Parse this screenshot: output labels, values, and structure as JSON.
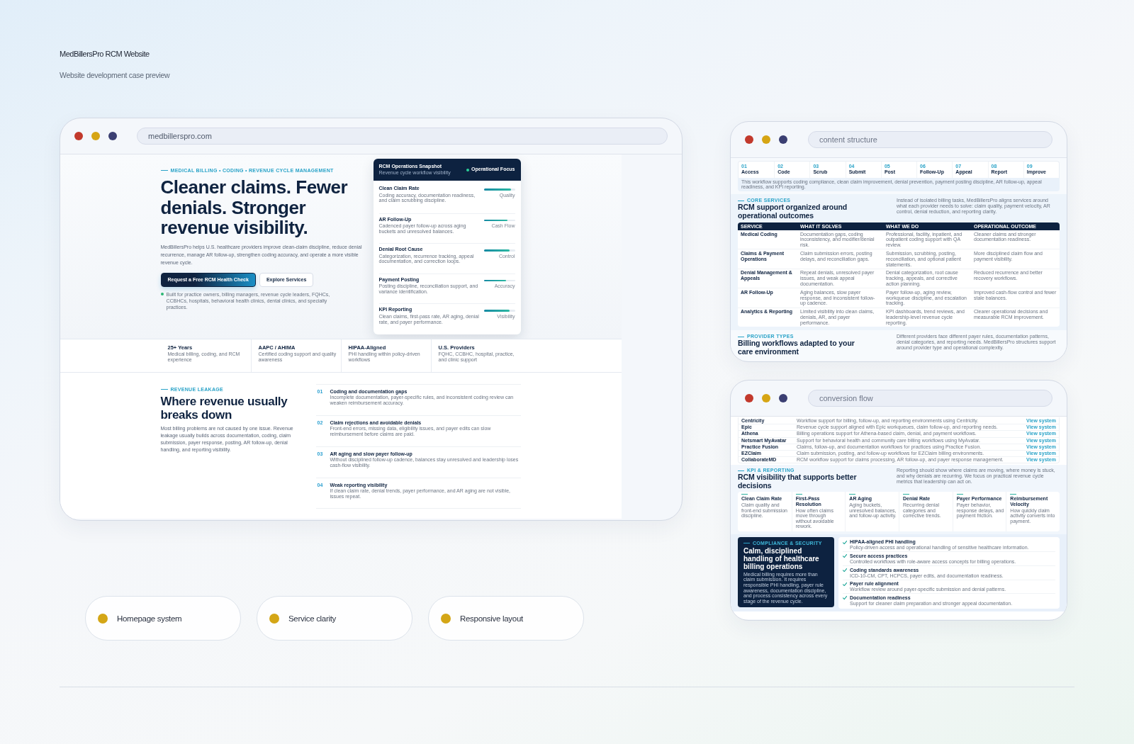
{
  "header": {
    "title": "MedBillersPro RCM Website",
    "subtitle": "Website development case preview"
  },
  "homepage_window": {
    "url": "medbillerspro.com",
    "hero": {
      "eyebrow": "MEDICAL BILLING • CODING • REVENUE CYCLE MANAGEMENT",
      "headline": "Cleaner claims. Fewer denials. Stronger revenue visibility.",
      "intro": "MedBillersPro helps U.S. healthcare providers improve clean-claim discipline, reduce denial recurrence, manage AR follow-up, strengthen coding accuracy, and operate a more visible revenue cycle.",
      "buttons": [
        {
          "label": "Request a Free RCM Health Check",
          "kind": "primary"
        },
        {
          "label": "Explore Services",
          "kind": "secondary"
        }
      ],
      "audience_note": "Built for practice owners, billing managers, revenue cycle leaders, FQHCs, CCBHCs, hospitals, behavioral health clinics, dental clinics, and specialty practices."
    },
    "snapshot": {
      "title": "RCM Operations Snapshot",
      "subtitle": "Revenue cycle workflow visibility",
      "status": "Operational Focus",
      "items": [
        {
          "name": "Clean Claim Rate",
          "description": "Coding accuracy, documentation readiness, and claim scrubbing discipline.",
          "level": 0.88,
          "reading": "Quality"
        },
        {
          "name": "AR Follow-Up",
          "description": "Cadenced payer follow-up across aging buckets and unresolved balances.",
          "level": 0.76,
          "reading": "Cash Flow"
        },
        {
          "name": "Denial Root Cause",
          "description": "Categorization, recurrence tracking, appeal documentation, and correction loops.",
          "level": 0.82,
          "reading": "Control"
        },
        {
          "name": "Payment Posting",
          "description": "Posting discipline, reconciliation support, and variance identification.",
          "level": 0.71,
          "reading": "Accuracy"
        },
        {
          "name": "KPI Reporting",
          "description": "Clean claims, first-pass rate, AR aging, denial rate, and payer performance.",
          "level": 0.84,
          "reading": "Visibility"
        }
      ]
    },
    "stats": [
      {
        "value": "25+ Years",
        "caption": "Medical billing, coding, and RCM experience"
      },
      {
        "value": "AAPC / AHIMA",
        "caption": "Certified coding support and quality awareness"
      },
      {
        "value": "HIPAA-Aligned",
        "caption": "PHI handling within policy-driven workflows"
      },
      {
        "value": "U.S. Providers",
        "caption": "FQHC, CCBHC, hospital, practice, and clinic support"
      }
    ],
    "leakage": {
      "eyebrow": "REVENUE LEAKAGE",
      "heading": "Where revenue usually breaks down",
      "intro": "Most billing problems are not caused by one issue. Revenue leakage usually builds across documentation, coding, claim submission, payer response, posting, AR follow-up, denial handling, and reporting visibility.",
      "items": [
        {
          "number": "01",
          "title": "Coding and documentation gaps",
          "description": "Incomplete documentation, payer-specific rules, and inconsistent coding review can weaken reimbursement accuracy."
        },
        {
          "number": "02",
          "title": "Claim rejections and avoidable denials",
          "description": "Front-end errors, missing data, eligibility issues, and payer edits can slow reimbursement before claims are paid."
        },
        {
          "number": "03",
          "title": "AR aging and slow payer follow-up",
          "description": "Without disciplined follow-up cadence, balances stay unresolved and leadership loses cash-flow visibility."
        },
        {
          "number": "04",
          "title": "Weak reporting visibility",
          "description": "If clean claim rate, denial trends, payer performance, and AR aging are not visible, issues repeat."
        }
      ]
    }
  },
  "structure_window": {
    "url": "content structure",
    "workflow": {
      "steps": [
        {
          "number": "01",
          "label": "Access"
        },
        {
          "number": "02",
          "label": "Code"
        },
        {
          "number": "03",
          "label": "Scrub"
        },
        {
          "number": "04",
          "label": "Submit"
        },
        {
          "number": "05",
          "label": "Post"
        },
        {
          "number": "06",
          "label": "Follow-Up"
        },
        {
          "number": "07",
          "label": "Appeal"
        },
        {
          "number": "08",
          "label": "Report"
        },
        {
          "number": "09",
          "label": "Improve"
        }
      ],
      "note": "This workflow supports coding compliance, clean claim improvement, denial prevention, payment posting discipline, AR follow-up, appeal readiness, and KPI reporting."
    },
    "services": {
      "eyebrow": "CORE SERVICES",
      "heading": "RCM support organized around operational outcomes",
      "intro": "Instead of isolated billing tasks, MedBillersPro aligns services around what each provider needs to solve: claim quality, payment velocity, AR control, denial reduction, and reporting clarity.",
      "columns": [
        "SERVICE",
        "WHAT IT SOLVES",
        "WHAT WE DO",
        "OPERATIONAL OUTCOME"
      ],
      "rows": [
        [
          "Medical Coding",
          "Documentation gaps, coding inconsistency, and modifier/denial risk.",
          "Professional, facility, inpatient, and outpatient coding support with QA review.",
          "Cleaner claims and stronger documentation readiness."
        ],
        [
          "Claims & Payment Operations",
          "Claim submission errors, posting delays, and reconciliation gaps.",
          "Submission, scrubbing, posting, reconciliation, and optional patient statements.",
          "More disciplined claim flow and payment visibility."
        ],
        [
          "Denial Management & Appeals",
          "Repeat denials, unresolved payer issues, and weak appeal documentation.",
          "Denial categorization, root cause tracking, appeals, and corrective action planning.",
          "Reduced recurrence and better recovery workflows."
        ],
        [
          "AR Follow-Up",
          "Aging balances, slow payer response, and inconsistent follow-up cadence.",
          "Payer follow-up, aging review, workqueue discipline, and escalation tracking.",
          "Improved cash-flow control and fewer stale balances."
        ],
        [
          "Analytics & Reporting",
          "Limited visibility into clean claims, denials, AR, and payer performance.",
          "KPI dashboards, trend reviews, and leadership-level revenue cycle reporting.",
          "Clearer operational decisions and measurable RCM improvement."
        ]
      ]
    },
    "provider_types": {
      "eyebrow": "PROVIDER TYPES",
      "heading": "Billing workflows adapted to your care environment",
      "intro": "Different providers face different payer rules, documentation patterns, denial categories, and reporting needs. MedBillersPro structures support around provider type and operational complexity."
    }
  },
  "conversion_window": {
    "url": "conversion flow",
    "systems": [
      {
        "name": "Centricity",
        "description": "Workflow support for billing, follow-up, and reporting environments using Centricity.",
        "link": "View system"
      },
      {
        "name": "Epic",
        "description": "Revenue cycle support aligned with Epic workqueues, claim follow-up, and reporting needs.",
        "link": "View system"
      },
      {
        "name": "Athena",
        "description": "Billing operations support for Athena-based claim, denial, and payment workflows.",
        "link": "View system"
      },
      {
        "name": "Netsmart MyAvatar",
        "description": "Support for behavioral health and community care billing workflows using MyAvatar.",
        "link": "View system"
      },
      {
        "name": "Practice Fusion",
        "description": "Claims, follow-up, and documentation workflows for practices using Practice Fusion.",
        "link": "View system"
      },
      {
        "name": "EZClaim",
        "description": "Claim submission, posting, and follow-up workflows for EZClaim billing environments.",
        "link": "View system"
      },
      {
        "name": "CollaborateMD",
        "description": "RCM workflow support for claims processing, AR follow-up, and payer response management.",
        "link": "View system"
      }
    ],
    "kpi": {
      "eyebrow": "KPI & REPORTING",
      "heading": "RCM visibility that supports better decisions",
      "intro": "Reporting should show where claims are moving, where money is stuck, and why denials are recurring. We focus on practical revenue cycle metrics that leadership can act on.",
      "cards": [
        {
          "title": "Clean Claim Rate",
          "description": "Claim quality and front-end submission discipline."
        },
        {
          "title": "First-Pass Resolution",
          "description": "How often claims move through without avoidable rework."
        },
        {
          "title": "AR Aging",
          "description": "Aging buckets, unresolved balances, and follow-up activity."
        },
        {
          "title": "Denial Rate",
          "description": "Recurring denial categories and corrective trends."
        },
        {
          "title": "Payer Performance",
          "description": "Payer behavior, response delays, and payment friction."
        },
        {
          "title": "Reimbursement Velocity",
          "description": "How quickly claim activity converts into payment."
        }
      ]
    },
    "compliance": {
      "eyebrow": "COMPLIANCE & SECURITY",
      "heading": "Calm, disciplined handling of healthcare billing operations",
      "intro": "Medical billing requires more than claim submission. It requires responsible PHI handling, payer rule awareness, documentation discipline, and process consistency across every stage of the revenue cycle.",
      "items": [
        {
          "title": "HIPAA-aligned PHI handling",
          "description": "Policy-driven access and operational handling of sensitive healthcare information."
        },
        {
          "title": "Secure access practices",
          "description": "Controlled workflows with role-aware access concepts for billing operations."
        },
        {
          "title": "Coding standards awareness",
          "description": "ICD-10-CM, CPT, HCPCS, payer edits, and documentation readiness."
        },
        {
          "title": "Payer rule alignment",
          "description": "Workflow review around payer-specific submission and denial patterns."
        },
        {
          "title": "Documentation readiness",
          "description": "Support for cleaner claim preparation and stronger appeal documentation."
        }
      ]
    }
  },
  "highlights": [
    "Homepage system",
    "Service clarity",
    "Responsive layout"
  ]
}
